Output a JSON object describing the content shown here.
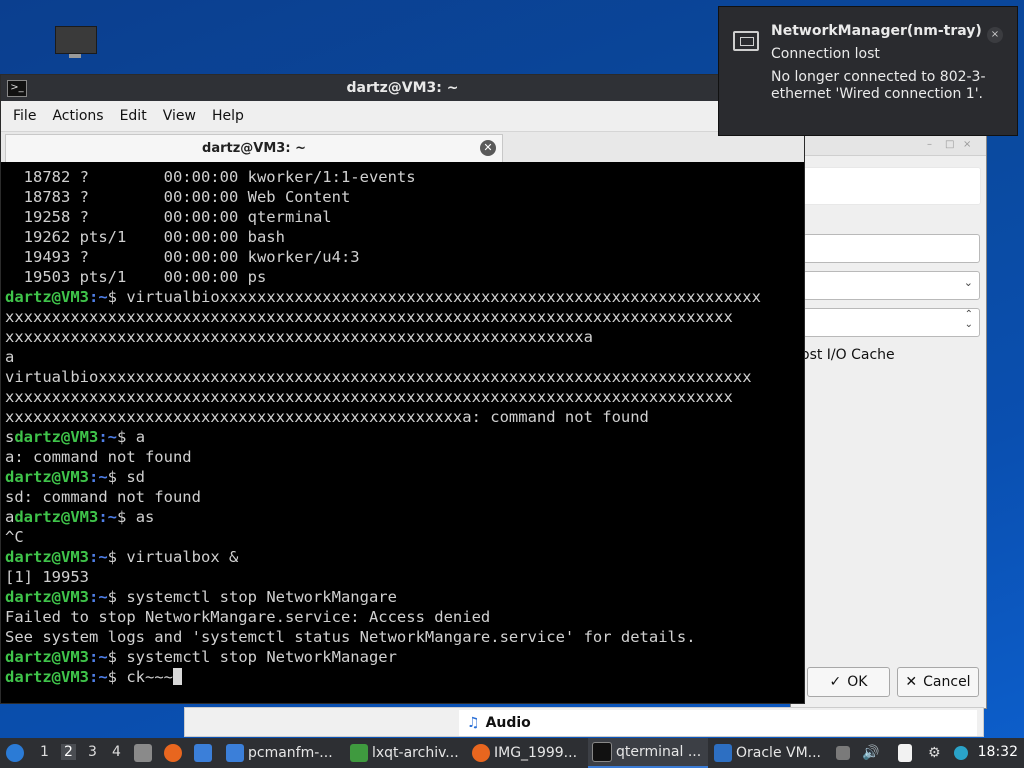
{
  "terminal": {
    "window_title": "dartz@VM3: ~",
    "menu": [
      "File",
      "Actions",
      "Edit",
      "View",
      "Help"
    ],
    "tab_title": "dartz@VM3: ~",
    "prompt_user": "dartz@VM3",
    "prompt_path": ":~",
    "prompt_symbol": "$ ",
    "lines": [
      {
        "type": "out",
        "text": "  18782 ?        00:00:00 kworker/1:1-events"
      },
      {
        "type": "out",
        "text": "  18783 ?        00:00:00 Web Content"
      },
      {
        "type": "out",
        "text": "  19258 ?        00:00:00 qterminal"
      },
      {
        "type": "out",
        "text": "  19262 pts/1    00:00:00 bash"
      },
      {
        "type": "out",
        "text": "  19493 ?        00:00:00 kworker/u4:3"
      },
      {
        "type": "out",
        "text": "  19503 pts/1    00:00:00 ps"
      },
      {
        "type": "cmd",
        "pre": "",
        "cmd": "virtualbioxxxxxxxxxxxxxxxxxxxxxxxxxxxxxxxxxxxxxxxxxxxxxxxxxxxxxxxxxx"
      },
      {
        "type": "out",
        "text": "xxxxxxxxxxxxxxxxxxxxxxxxxxxxxxxxxxxxxxxxxxxxxxxxxxxxxxxxxxxxxxxxxxxxxxxxxxxxxx"
      },
      {
        "type": "out",
        "text": "xxxxxxxxxxxxxxxxxxxxxxxxxxxxxxxxxxxxxxxxxxxxxxxxxxxxxxxxxxxxxxa"
      },
      {
        "type": "out",
        "text": "a"
      },
      {
        "type": "out",
        "text": "virtualbioxxxxxxxxxxxxxxxxxxxxxxxxxxxxxxxxxxxxxxxxxxxxxxxxxxxxxxxxxxxxxxxxxxxxxx"
      },
      {
        "type": "out",
        "text": "xxxxxxxxxxxxxxxxxxxxxxxxxxxxxxxxxxxxxxxxxxxxxxxxxxxxxxxxxxxxxxxxxxxxxxxxxxxxxx"
      },
      {
        "type": "out",
        "text": "xxxxxxxxxxxxxxxxxxxxxxxxxxxxxxxxxxxxxxxxxxxxxxxxxa: command not found"
      },
      {
        "type": "cmd",
        "pre": "s",
        "cmd": "a"
      },
      {
        "type": "out",
        "text": "a: command not found"
      },
      {
        "type": "cmd",
        "pre": "",
        "cmd": "sd"
      },
      {
        "type": "out",
        "text": "sd: command not found"
      },
      {
        "type": "cmd",
        "pre": "a",
        "cmd": "as"
      },
      {
        "type": "out",
        "text": "^C"
      },
      {
        "type": "cmd",
        "pre": "",
        "cmd": "virtualbox &"
      },
      {
        "type": "out",
        "text": "[1] 19953"
      },
      {
        "type": "cmd",
        "pre": "",
        "cmd": "systemctl stop NetworkMangare"
      },
      {
        "type": "out",
        "text": "Failed to stop NetworkMangare.service: Access denied"
      },
      {
        "type": "out",
        "text": "See system logs and 'systemctl status NetworkMangare.service' for details."
      },
      {
        "type": "cmd",
        "pre": "",
        "cmd": "systemctl stop NetworkManager"
      },
      {
        "type": "cmd",
        "pre": "",
        "cmd": "ck~~~",
        "cursor": true
      }
    ]
  },
  "notification": {
    "title": "NetworkManager(nm-tray)",
    "subtitle": "Connection lost",
    "body": "No longer connected to 802-3-ethernet 'Wired connection 1'.",
    "close": "×"
  },
  "dialog": {
    "partial_label": "ost I/O Cache",
    "ok_label": "OK",
    "cancel_label": "Cancel"
  },
  "audio_strip": {
    "label": "Audio"
  },
  "taskbar": {
    "desktops": [
      "1",
      "2",
      "3",
      "4"
    ],
    "current_desktop": "2",
    "tasks": [
      {
        "label": "pcmanfm-...",
        "icon": "folder-icon"
      },
      {
        "label": "lxqt-archiv...",
        "icon": "archive-icon"
      },
      {
        "label": "IMG_1999...",
        "icon": "firefox-icon"
      },
      {
        "label": "qterminal ...",
        "icon": "terminal-icon",
        "active": true
      },
      {
        "label": "Oracle VM...",
        "icon": "virtualbox-icon"
      }
    ],
    "clock": "18:32"
  },
  "colors": {
    "prompt_user": "#3fc44a",
    "prompt_path": "#4f7fe8",
    "terminal_bg": "#000000",
    "taskbar_bg": "#2d2f33"
  }
}
